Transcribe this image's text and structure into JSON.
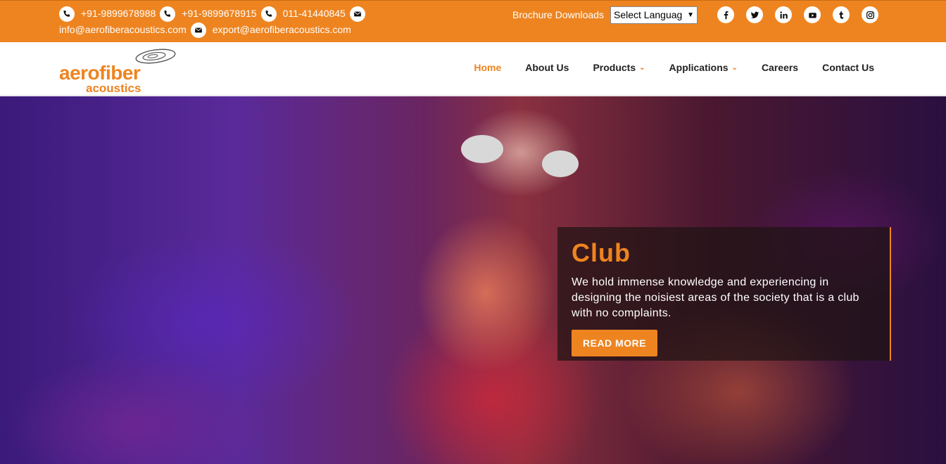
{
  "topbar": {
    "phone1": "+91-9899678988",
    "phone2": "+91-9899678915",
    "phone3": "011-41440845",
    "email1": "info@aerofiberacoustics.com",
    "email2": "export@aerofiberacoustics.com",
    "brochure": "Brochure Downloads",
    "language_select": "Select Languag",
    "social_icons": [
      "facebook-icon",
      "twitter-icon",
      "linkedin-icon",
      "youtube-icon",
      "tumblr-icon",
      "instagram-icon"
    ]
  },
  "logo": {
    "line1": "aerofiber",
    "line2": "acoustics"
  },
  "nav": {
    "items": [
      {
        "label": "Home",
        "active": true,
        "dropdown": false
      },
      {
        "label": "About Us",
        "active": false,
        "dropdown": false
      },
      {
        "label": "Products",
        "active": false,
        "dropdown": true
      },
      {
        "label": "Applications",
        "active": false,
        "dropdown": true
      },
      {
        "label": "Careers",
        "active": false,
        "dropdown": false
      },
      {
        "label": "Contact Us",
        "active": false,
        "dropdown": false
      }
    ]
  },
  "hero": {
    "title": "Club",
    "text": "We hold immense knowledge and experiencing in designing the noisiest areas of the society that is a club with no complaints.",
    "button": "READ MORE"
  },
  "colors": {
    "accent": "#ee8420"
  }
}
